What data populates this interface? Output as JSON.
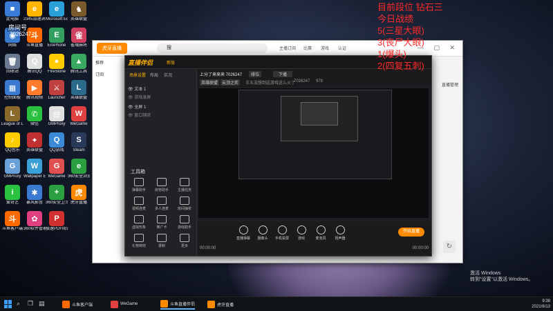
{
  "overlay": {
    "lines": [
      "目前段位 钻石三",
      "今日战绩",
      "5(三星大眼)",
      "3(丧尸大眼)",
      "1(爆头)",
      "2(四复五刺)"
    ],
    "room_label": "房间号",
    "room_number": "7026247"
  },
  "desktop_icons": [
    {
      "label": "此电脑",
      "color": "#3b7bd8",
      "glyph": "■"
    },
    {
      "label": "2345加速浏览器",
      "color": "#ffb400",
      "glyph": "e"
    },
    {
      "label": "Microsoft Edge",
      "color": "#2aa0d8",
      "glyph": "e"
    },
    {
      "label": "英雄联盟",
      "color": "#7a5a2a",
      "glyph": "♞"
    },
    {
      "label": "网络",
      "color": "#3a7ad0",
      "glyph": "◉"
    },
    {
      "label": "斗鱼直播",
      "color": "#ff6a00",
      "glyph": "斗"
    },
    {
      "label": "EroPhone",
      "color": "#33a060",
      "glyph": "E"
    },
    {
      "label": "雀魂麻将",
      "color": "#d04060",
      "glyph": "雀"
    },
    {
      "label": "回收站",
      "color": "#6a7a90",
      "glyph": "🗑"
    },
    {
      "label": "腾讯QQ",
      "color": "#e0e0e0",
      "glyph": "Q"
    },
    {
      "label": "FireStone",
      "color": "#ffcc00",
      "glyph": "●"
    },
    {
      "label": "腾讯工具",
      "color": "#3aaa60",
      "glyph": "▲"
    },
    {
      "label": "控制面板",
      "color": "#3a7ad0",
      "glyph": "▦"
    },
    {
      "label": "腾讯视频",
      "color": "#ff7a2a",
      "glyph": "▶"
    },
    {
      "label": "Launcher",
      "color": "#c04040",
      "glyph": "⚔"
    },
    {
      "label": "英雄联盟",
      "color": "#2a6a8a",
      "glyph": "L"
    },
    {
      "label": "League of Legends",
      "color": "#8a6a2a",
      "glyph": "L"
    },
    {
      "label": "微信",
      "color": "#2ac040",
      "glyph": "✆"
    },
    {
      "label": "GMProxy",
      "color": "#e0e0e0",
      "glyph": "▤"
    },
    {
      "label": "WeGame",
      "color": "#e04040",
      "glyph": "W"
    },
    {
      "label": "QQ音乐",
      "color": "#ffcc00",
      "glyph": "♪"
    },
    {
      "label": "英雄联盟",
      "color": "#c03030",
      "glyph": "✦"
    },
    {
      "label": "QQ游戏",
      "color": "#3a8ad8",
      "glyph": "Q"
    },
    {
      "label": "Steam",
      "color": "#2a3a5a",
      "glyph": "S"
    },
    {
      "label": "GMProxy",
      "color": "#6aa0d8",
      "glyph": "G"
    },
    {
      "label": "Wallpaper Engine",
      "color": "#3aa0d8",
      "glyph": "W"
    },
    {
      "label": "WeGame",
      "color": "#e05050",
      "glyph": "G"
    },
    {
      "label": "360安全浏览器",
      "color": "#2aa040",
      "glyph": "e"
    },
    {
      "label": "爱奇艺",
      "color": "#2ac040",
      "glyph": "i"
    },
    {
      "label": "暴风影音",
      "color": "#3a7ad0",
      "glyph": "✱"
    },
    {
      "label": "360安全卫士",
      "color": "#2aa040",
      "glyph": "+"
    },
    {
      "label": "虎牙直播",
      "color": "#ff8a00",
      "glyph": "虎"
    },
    {
      "label": "斗鱼客户端",
      "color": "#ff6a00",
      "glyph": "斗"
    },
    {
      "label": "360软件管家",
      "color": "#e04080",
      "glyph": "✿"
    },
    {
      "label": "极速PDF阅读器",
      "color": "#d03030",
      "glyph": "P"
    }
  ],
  "app": {
    "logo": "虎牙直播",
    "search": "搜",
    "nav_items": [
      "主播订阅",
      "比赛",
      "游戏",
      "认证"
    ],
    "side_items": [
      "推荐",
      "订阅"
    ],
    "right_label": "直播管理"
  },
  "companion": {
    "logo": "直播伴侣",
    "version": "新版",
    "tabs": [
      "场景设置",
      "布局",
      "实况"
    ],
    "scenes": [
      "文本 1",
      "游戏录屏",
      "全屏 1",
      "窗口捕获"
    ],
    "tools_title": "工具箱",
    "tools": [
      "弹幕助手",
      "房管助手",
      "主播任务",
      "视频连麦",
      "多人连麦",
      "房间抽奖",
      "虚拟形象",
      "推广卡",
      "游戏助手",
      "礼物特效",
      "录制",
      "更多"
    ],
    "info_title": "上分了来来来 7026247",
    "info_rank": "排位",
    "info_mode": "下播",
    "info_tags": [
      "英雄联盟",
      "云顶之弈"
    ],
    "info_notice": "王五没想到这游戏这么火了",
    "info_room": "7026247",
    "info_count": "978",
    "bottom_buttons": [
      "直播弹幕",
      "摄像头",
      "手机投屏",
      "游戏",
      "麦克风",
      "扬声器"
    ],
    "start_label": "开始直播",
    "time_left": "00:00:00",
    "time_right": "00:00:00",
    "footer_note": "斗鱼直播伴侣帮助中心"
  },
  "taskbar": {
    "apps": [
      {
        "label": "斗鱼客户端",
        "color": "#ff6a00"
      },
      {
        "label": "WeGame",
        "color": "#e04040"
      },
      {
        "label": "斗鱼直播伴侣",
        "color": "#ff8a00"
      },
      {
        "label": "虎牙直播",
        "color": "#ff8a00"
      }
    ],
    "time": "9:38",
    "date": "2021/8/13"
  },
  "watermark": {
    "line1": "激活 Windows",
    "line2": "转到\"设置\"以激活 Windows。"
  }
}
